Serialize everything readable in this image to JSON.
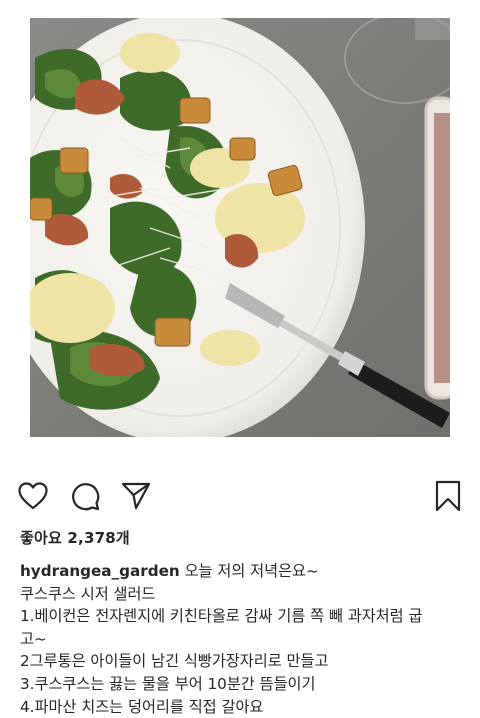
{
  "post": {
    "image_alt": "Couscous Caesar salad on a white plate with a fork",
    "likes_text": "좋아요 2,378개",
    "username": "hydrangea_garden",
    "caption_lines": [
      "오늘 저의 저녁은요~",
      "쿠스쿠스 시저 샐러드",
      "1.베이컨은 전자렌지에 키친타올로 감싸 기름 쪽 빼 과자처럼 굽",
      "고~",
      "2그루통은 아이들이 남긴 식빵가장자리로 만들고",
      "3.쿠스쿠스는 끓는 물을 부어 10분간 뜸들이기",
      "4.파마산 치즈는 덩어리를 직접 갈아요"
    ]
  },
  "actions": {
    "like": "heart-icon",
    "comment": "comment-icon",
    "share": "send-icon",
    "save": "bookmark-icon"
  },
  "colors": {
    "text": "#262626",
    "icon": "#262626",
    "table": "#7d7e7b",
    "plate": "#f4f3ef"
  }
}
